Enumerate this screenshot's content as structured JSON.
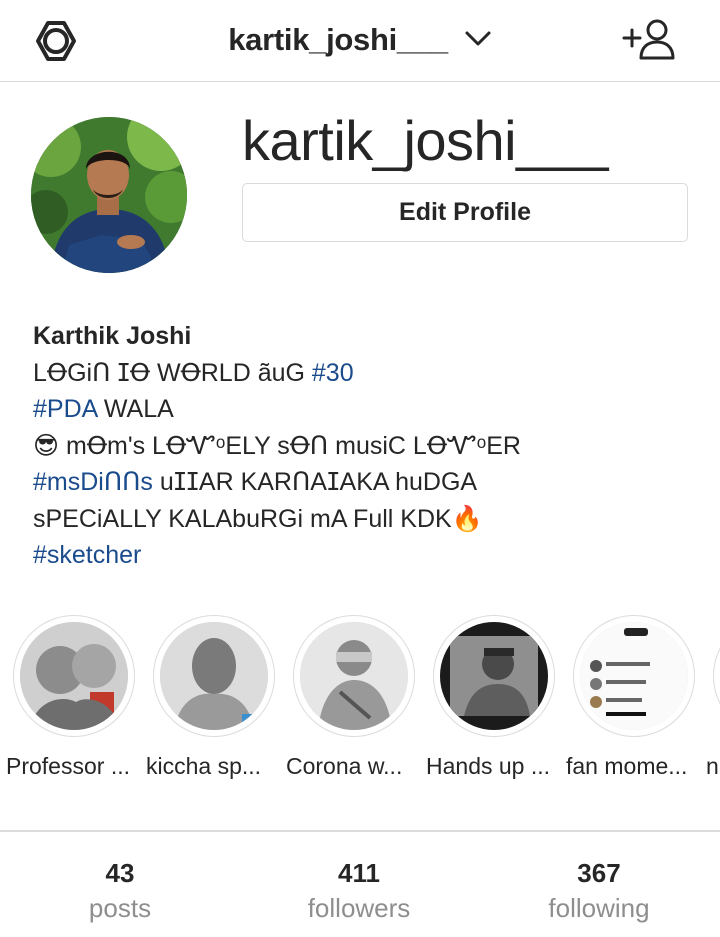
{
  "header": {
    "account_name": "kartik_joshi___",
    "icons": {
      "settings": "gear-icon",
      "switch_account": "chevron-down-icon",
      "add_person": "add-person-icon"
    }
  },
  "profile": {
    "username": "kartik_joshi___",
    "edit_button": "Edit Profile",
    "avatar": "profile-photo"
  },
  "bio": {
    "name": "Karthik Joshi",
    "line1_text": "LꝊGiᑎ ⵊꝊ WꝊRLD ãuG ",
    "line1_tag": "#30",
    "line2_tag": "#PDA",
    "line2_text": " WALA",
    "line3_emoji": "😎",
    "line3_text": " mꝊm's LꝊᏉᵒELY sꝊᑎ musiC LꝊᏉᵒER",
    "line4_tag": "#msDiᑎᑎs",
    "line4_text": " uⵊⵊAR KARᑎAⵊAKA huDGA",
    "line5_text": "sPECiALLY KALAbuRGi mA Full KDK",
    "line5_emoji": "🔥",
    "line6_tag": "#sketcher"
  },
  "highlights": [
    {
      "label": "Professor ..."
    },
    {
      "label": "kiccha sp..."
    },
    {
      "label": "Corona w..."
    },
    {
      "label": "Hands up ..."
    },
    {
      "label": "fan mome..."
    },
    {
      "label": "n"
    }
  ],
  "stats": {
    "posts": {
      "value": "43",
      "label": "posts"
    },
    "followers": {
      "value": "411",
      "label": "followers"
    },
    "following": {
      "value": "367",
      "label": "following"
    }
  },
  "colors": {
    "hashtag": "#1a4b8c",
    "border": "#dbdbdb",
    "muted": "#8e8e8e",
    "text": "#262626"
  }
}
